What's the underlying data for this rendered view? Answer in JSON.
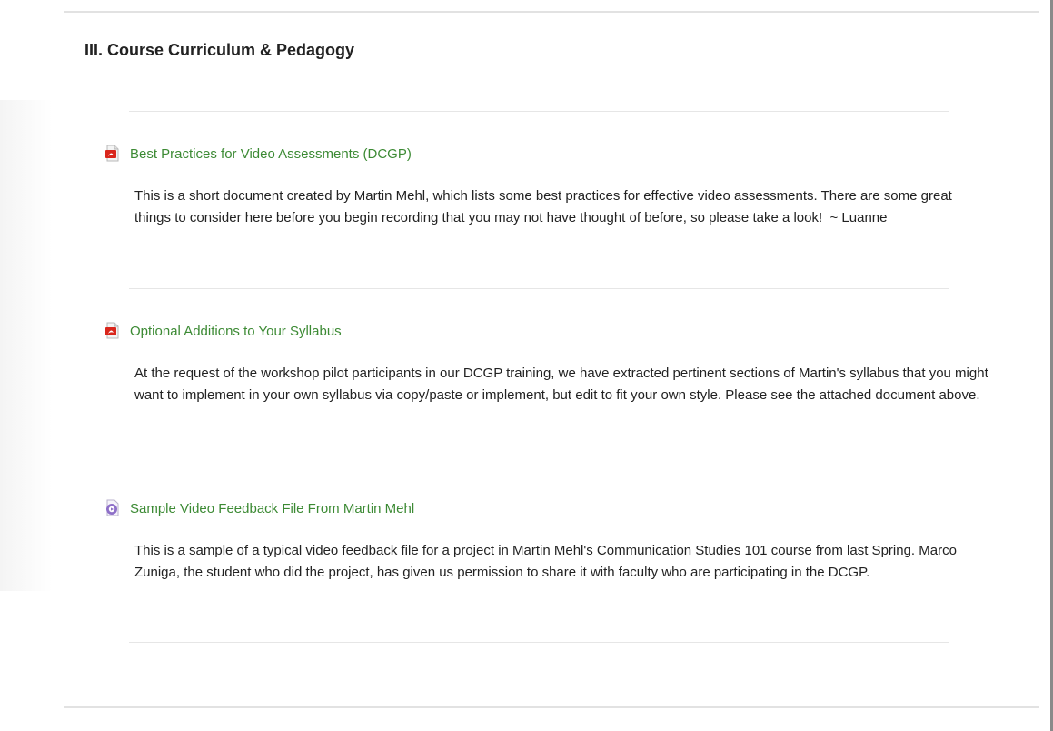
{
  "section": {
    "title": "III. Course Curriculum & Pedagogy"
  },
  "items": [
    {
      "icon": "pdf-file-icon",
      "title": "Best Practices for Video Assessments (DCGP)",
      "description": "This is a short document created by Martin Mehl, which lists some best practices for effective video assessments. There are some great things to consider here before you begin recording that you may not have thought of before, so please take a look!  ~ Luanne"
    },
    {
      "icon": "pdf-file-icon",
      "title": "Optional Additions to Your Syllabus",
      "description": "At the request of the workshop pilot participants in our DCGP training, we have extracted pertinent sections of Martin's syllabus that you might want to implement in your own syllabus via copy/paste or implement, but edit to fit your own style. Please see the attached document above."
    },
    {
      "icon": "video-file-icon",
      "title": "Sample Video Feedback File From Martin Mehl",
      "description": "This is a sample of a typical video feedback file for a project in Martin Mehl's Communication Studies 101 course from last Spring. Marco Zuniga, the student who did the project, has given us permission to share it with faculty who are participating in the DCGP."
    }
  ],
  "colors": {
    "link": "#3c8a34",
    "pdf_icon": "#d9261c",
    "video_icon": "#8e6fc8",
    "rule": "#e2e2e2"
  }
}
